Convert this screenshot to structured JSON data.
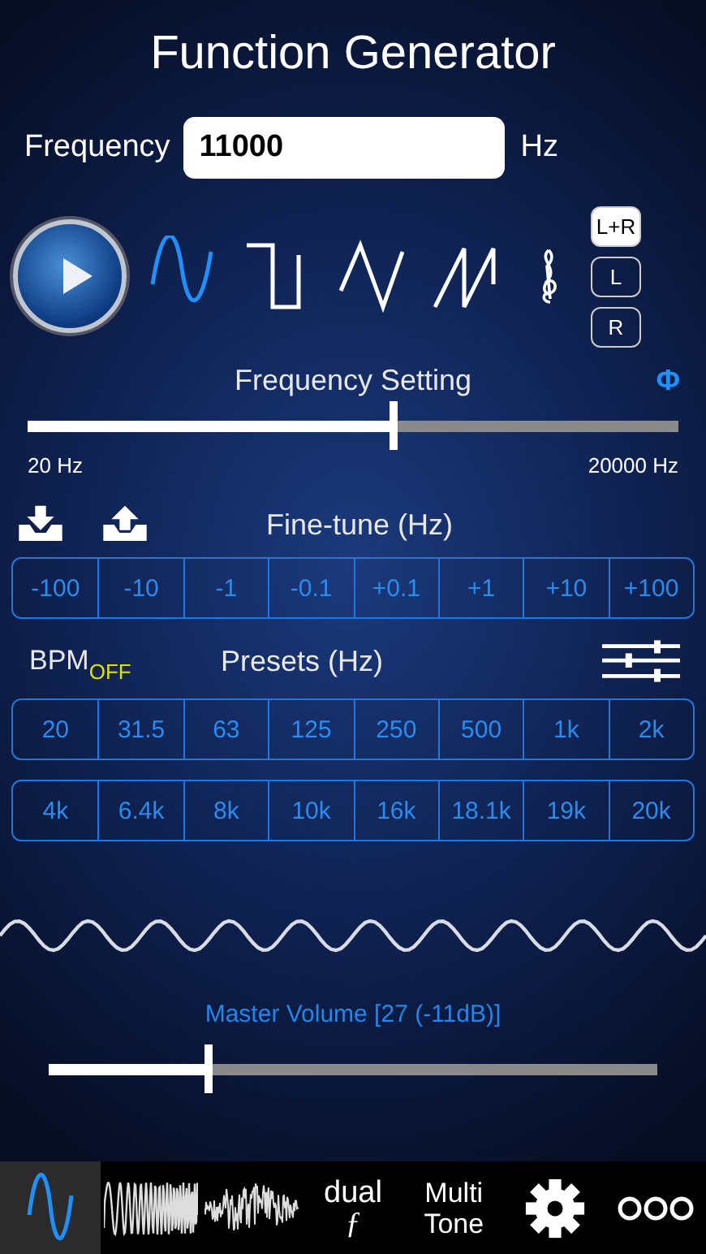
{
  "title": "Function Generator",
  "frequency": {
    "label": "Frequency",
    "value": "11000",
    "unit": "Hz"
  },
  "playing": false,
  "waveforms": [
    {
      "kind": "sine",
      "selected": true
    },
    {
      "kind": "square",
      "selected": false
    },
    {
      "kind": "triangle",
      "selected": false
    },
    {
      "kind": "sawtooth",
      "selected": false
    }
  ],
  "channels": [
    {
      "label": "L+R",
      "selected": true
    },
    {
      "label": "L",
      "selected": false
    },
    {
      "label": "R",
      "selected": false
    }
  ],
  "frequency_setting": {
    "label": "Frequency Setting",
    "phase": "Φ",
    "level": 0.56,
    "min": "20 Hz",
    "max": "20000 Hz"
  },
  "fine_tune": {
    "label": "Fine-tune (Hz)",
    "steps": [
      "-100",
      "-10",
      "-1",
      "-0.1",
      "+0.1",
      "+1",
      "+10",
      "+100"
    ]
  },
  "bpm": {
    "label": "BPM",
    "status": "OFF"
  },
  "presets": {
    "label": "Presets (Hz)",
    "rows": [
      [
        "20",
        "31.5",
        "63",
        "125",
        "250",
        "500",
        "1k",
        "2k"
      ],
      [
        "4k",
        "6.4k",
        "8k",
        "10k",
        "16k",
        "18.1k",
        "19k",
        "20k"
      ]
    ]
  },
  "master_volume": {
    "label": "Master Volume [27 (-11dB)]",
    "level": 0.26
  },
  "tabs": [
    {
      "kind": "sine",
      "selected": true
    },
    {
      "kind": "sweep",
      "selected": false
    },
    {
      "kind": "noise",
      "selected": false
    },
    {
      "kind": "dual",
      "label": "dual",
      "sublabel": "ƒ",
      "selected": false
    },
    {
      "kind": "text",
      "label": "Multi Tone",
      "selected": false
    },
    {
      "kind": "settings",
      "selected": false
    },
    {
      "kind": "more",
      "selected": false
    }
  ]
}
